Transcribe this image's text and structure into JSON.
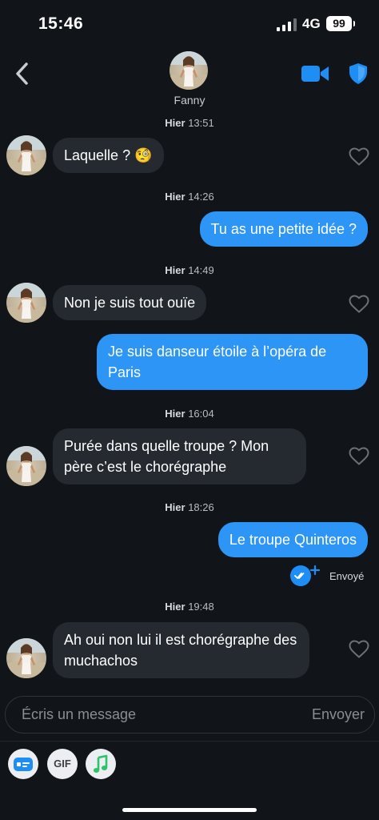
{
  "status_bar": {
    "time": "15:46",
    "network": "4G",
    "battery": "99"
  },
  "header": {
    "contact_name": "Fanny"
  },
  "messages": [
    {
      "timestamp_day": "Hier",
      "timestamp_time": "13:51",
      "text": "Laquelle ? 🧐",
      "direction": "in"
    },
    {
      "timestamp_day": "Hier",
      "timestamp_time": "14:26",
      "text": "Tu as une petite idée ?",
      "direction": "out"
    },
    {
      "timestamp_day": "Hier",
      "timestamp_time": "14:49",
      "text": "Non je suis tout ouïe",
      "direction": "in"
    },
    {
      "text": "Je suis danseur étoile à l’opéra de Paris",
      "direction": "out"
    },
    {
      "timestamp_day": "Hier",
      "timestamp_time": "16:04",
      "text": "Purée dans quelle troupe ? Mon père c’est le chorégraphe",
      "direction": "in"
    },
    {
      "timestamp_day": "Hier",
      "timestamp_time": "18:26",
      "text": "Le troupe Quinteros",
      "direction": "out"
    },
    {
      "timestamp_day": "Hier",
      "timestamp_time": "19:48",
      "text": "Ah oui non lui il est chorégraphe des muchachos",
      "direction": "in"
    }
  ],
  "delivery_status": "Envoyé",
  "composer": {
    "placeholder": "Écris un message",
    "send_label": "Envoyer"
  },
  "toolbar": {
    "gif_label": "GIF"
  },
  "colors": {
    "background": "#111418",
    "outgoing_bubble": "#2d95f5",
    "incoming_bubble": "#252a31",
    "accent": "#1e8ef5"
  },
  "icons": [
    "back-chevron-icon",
    "video-call-icon",
    "shield-icon",
    "heart-icon",
    "read-receipt-icon",
    "card-icon",
    "music-note-icon"
  ]
}
